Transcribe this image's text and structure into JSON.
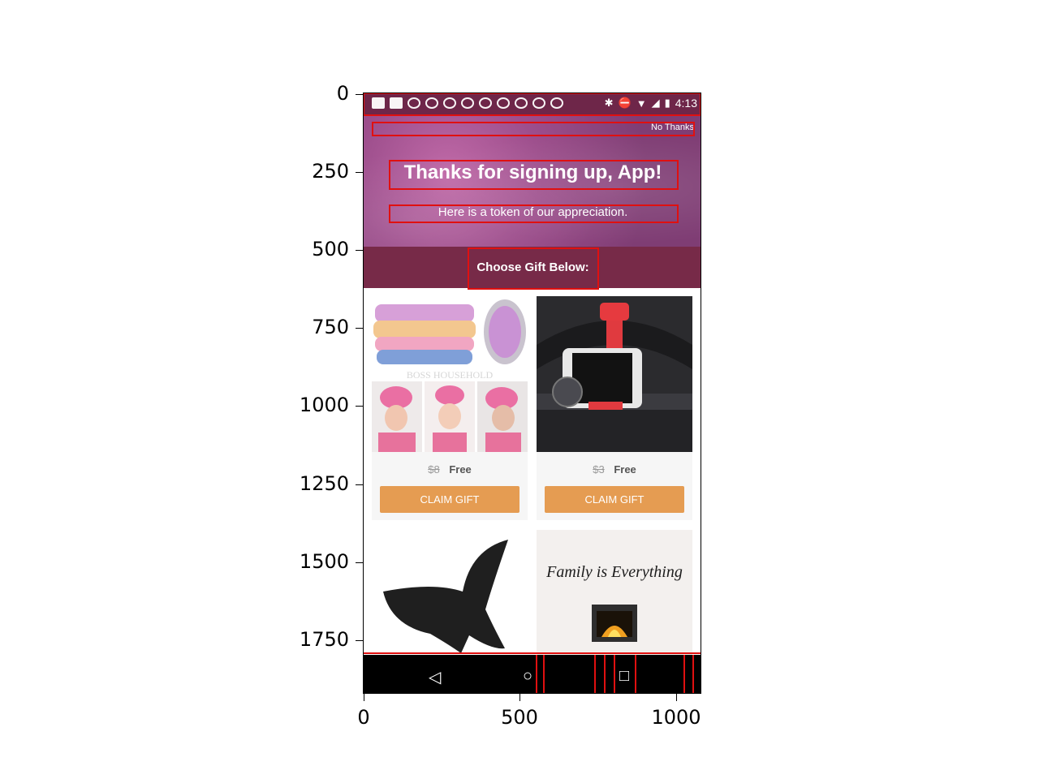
{
  "axes": {
    "y_ticks": [
      "0",
      "250",
      "500",
      "750",
      "1000",
      "1250",
      "1500",
      "1750"
    ],
    "x_ticks": [
      "0",
      "500",
      "1000"
    ]
  },
  "statusbar": {
    "time": "4:13",
    "icons": [
      "message-icon",
      "facebook-icon",
      "app-icon",
      "app-icon",
      "app-icon",
      "app-icon",
      "app-icon",
      "app-icon",
      "app-icon",
      "app-icon",
      "app-icon",
      "bluetooth-icon",
      "dnd-icon",
      "wifi-icon",
      "signal-icon",
      "battery-icon"
    ]
  },
  "hero": {
    "no_thanks": "No Thanks",
    "title": "Thanks for signing up, App!",
    "subtitle": "Here is a token of our appreciation."
  },
  "choose_label": "Choose Gift Below:",
  "gifts": [
    {
      "old_price": "$8",
      "price": "Free",
      "cta": "CLAIM GIFT",
      "watermark": "BOSS HOUSEHOLD"
    },
    {
      "old_price": "$3",
      "price": "Free",
      "cta": "CLAIM GIFT"
    },
    {
      "text": ""
    },
    {
      "text": "Family is Everything"
    }
  ],
  "colors": {
    "status": "#6e2649",
    "hero": "#8b447d",
    "choose_bar": "#772a48",
    "claim_button": "#e59c52",
    "annotation": "#e01010"
  }
}
